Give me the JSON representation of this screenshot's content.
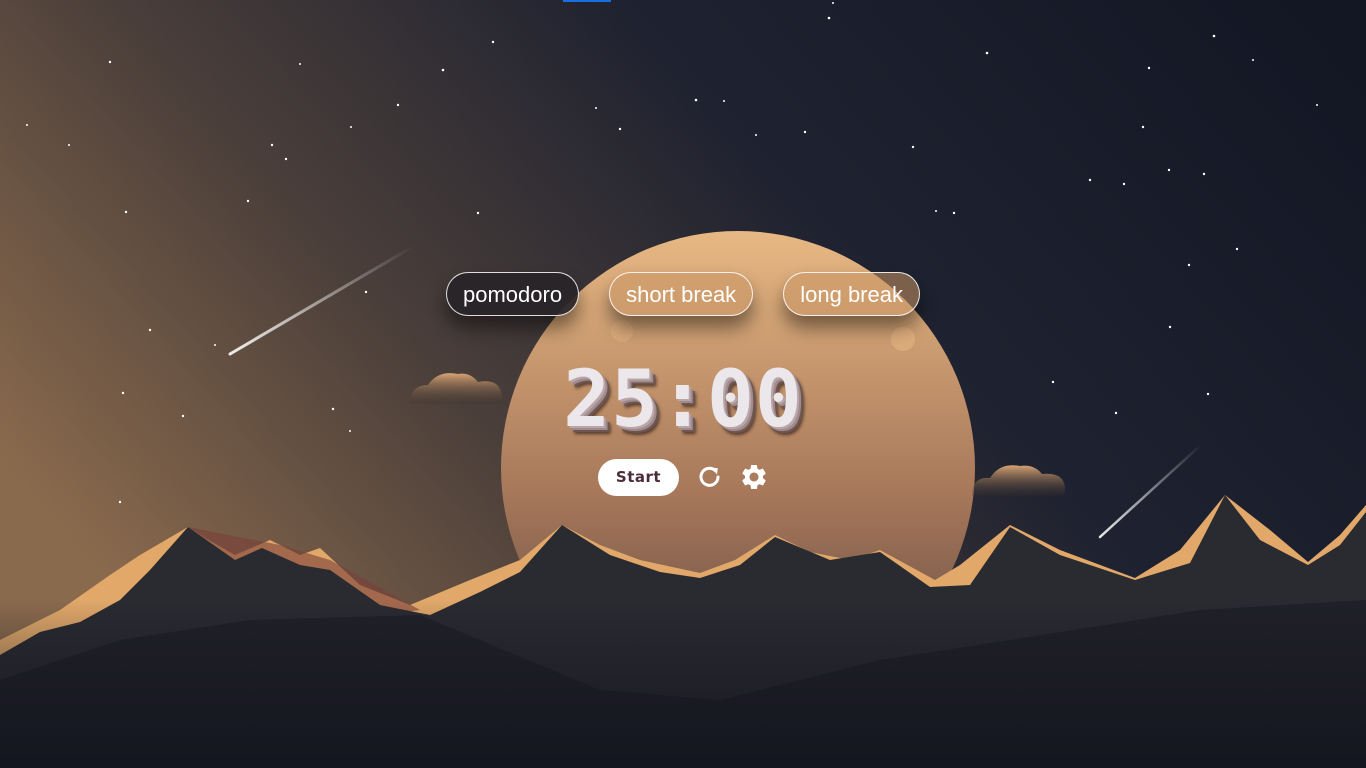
{
  "app": {
    "modes": [
      {
        "label": "pomodoro",
        "active": true
      },
      {
        "label": "short break",
        "active": false
      },
      {
        "label": "long break",
        "active": false
      }
    ],
    "timer": {
      "display": "25:00"
    },
    "controls": {
      "start_label": "Start",
      "reset_icon": "reset-icon",
      "settings_icon": "gear-icon"
    }
  },
  "colors": {
    "sky_top_right": "#141826",
    "sky_left_warm": "#8a6a4d",
    "moon_light": "#e8b883",
    "moon_dark": "#6e5447",
    "mountain_dark": "#23232b",
    "mountain_highlight": "#e1a86a",
    "active_mode_bg": "#282428",
    "start_text": "#4a2c3a",
    "accent_bar": "#1a6fe0"
  }
}
